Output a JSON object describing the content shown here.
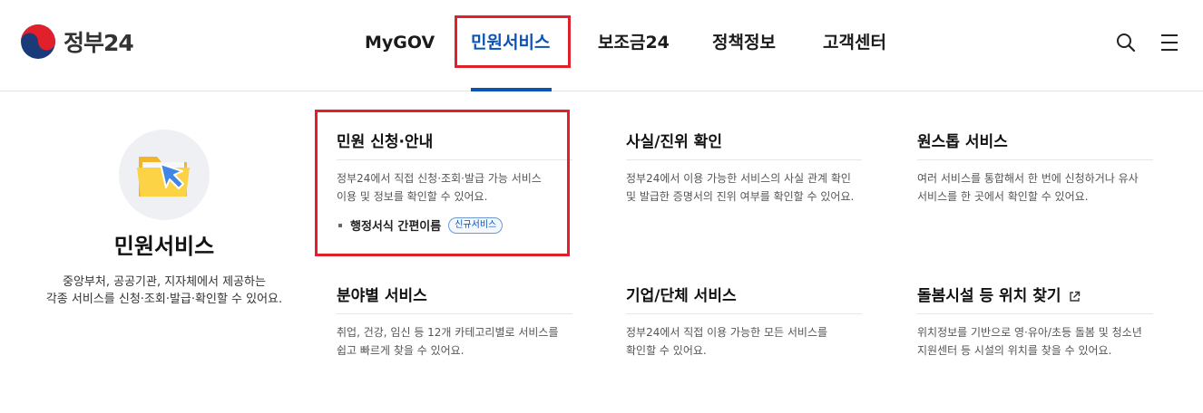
{
  "header": {
    "logo_text": "정부24",
    "nav": [
      "MyGOV",
      "민원서비스",
      "보조금24",
      "정책정보",
      "고객센터"
    ],
    "active_index": 1
  },
  "intro": {
    "title": "민원서비스",
    "desc_line1": "중앙부처, 공공기관, 지자체에서 제공하는",
    "desc_line2": "각종 서비스를 신청·조회·발급·확인할 수 있어요."
  },
  "cards": [
    {
      "title": "민원 신청·안내",
      "desc_line1": "정부24에서 직접 신청·조회·발급 가능 서비스",
      "desc_line2": "이용 및 정보를 확인할 수 있어요.",
      "sub_link": "행정서식 간편이름",
      "badge": "신규서비스"
    },
    {
      "title": "사실/진위 확인",
      "desc_line1": "정부24에서 이용 가능한 서비스의 사실 관계 확인",
      "desc_line2": "및 발급한 증명서의 진위 여부를 확인할 수 있어요."
    },
    {
      "title": "원스톱 서비스",
      "desc_line1": "여러 서비스를 통합해서 한 번에 신청하거나 유사",
      "desc_line2": "서비스를 한 곳에서 확인할 수 있어요."
    },
    {
      "title": "분야별 서비스",
      "desc_line1": "취업, 건강, 임신 등 12개 카테고리별로 서비스를",
      "desc_line2": "쉽고 빠르게 찾을 수 있어요."
    },
    {
      "title": "기업/단체 서비스",
      "desc_line1": "정부24에서 직접 이용 가능한 모든 서비스를",
      "desc_line2": "확인할 수 있어요."
    },
    {
      "title": "돌봄시설 등 위치 찾기",
      "desc_line1": "위치정보를 기반으로 영·유아/초등 돌봄 및 청소년",
      "desc_line2": "지원센터 등 시설의 위치를 찾을 수 있어요.",
      "external_icon": "external-link-icon"
    }
  ],
  "icons": {
    "logo": "taegeuk-logo-icon",
    "search": "search-icon",
    "menu": "hamburger-menu-icon",
    "intro": "folder-cursor-icon"
  },
  "colors": {
    "accent": "#0b54b5",
    "highlight": "#e0202a",
    "text": "#1b1b1b"
  }
}
